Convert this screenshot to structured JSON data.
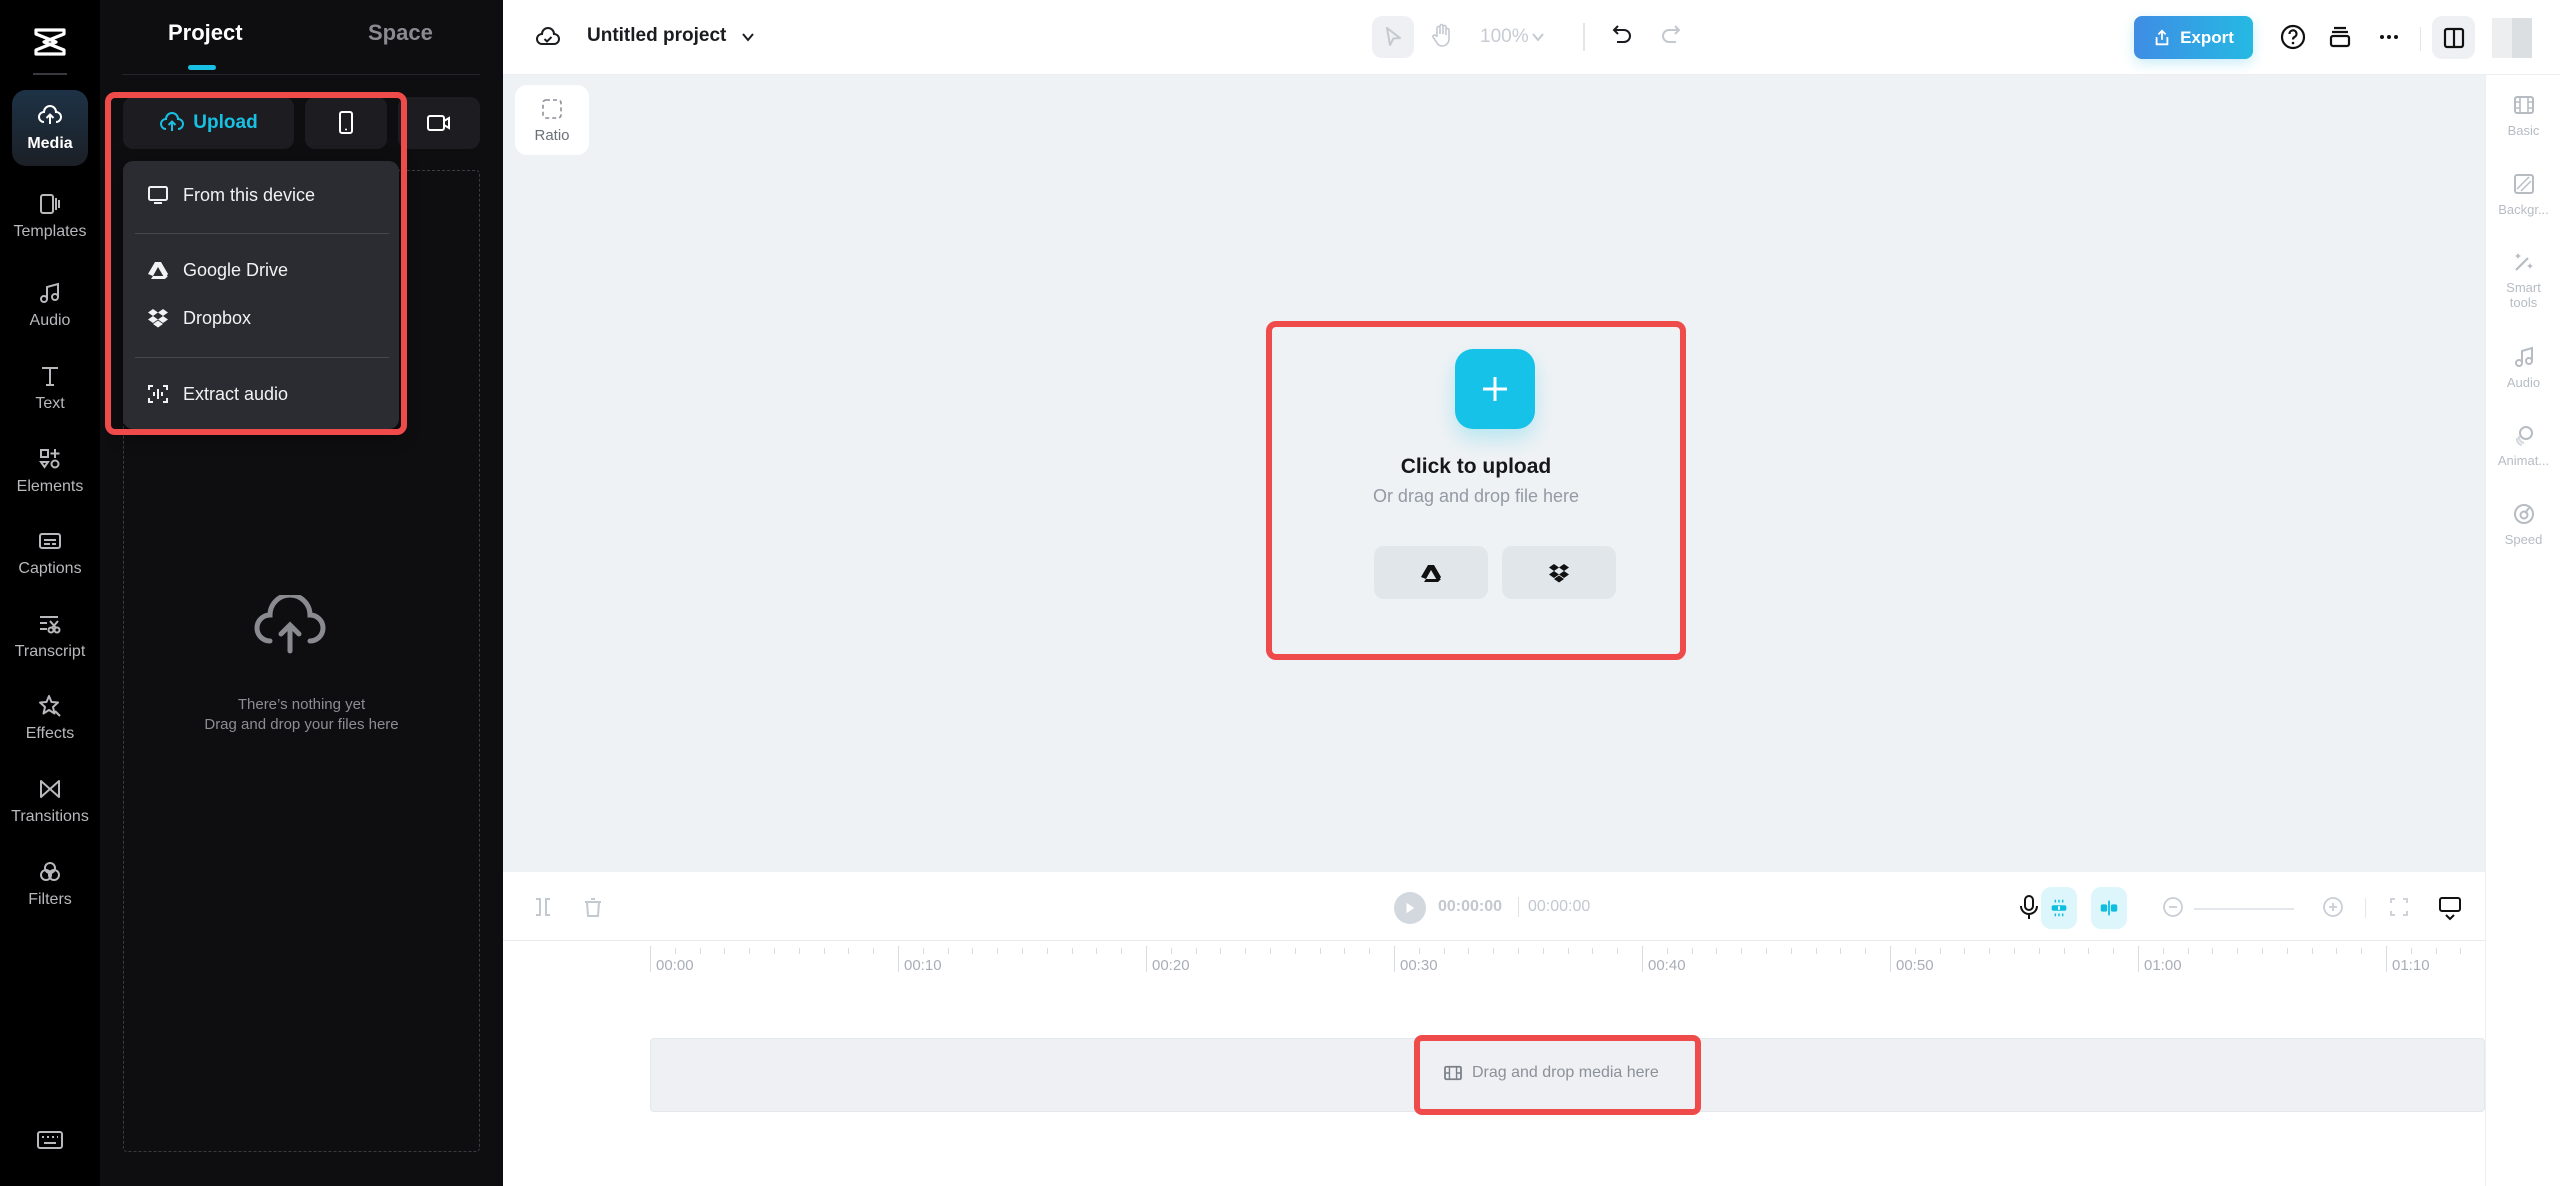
{
  "app": {
    "logo": "capcut-logo-icon"
  },
  "rail": {
    "items": [
      {
        "label": "Media",
        "icon": "cloud-upload-icon",
        "active": true
      },
      {
        "label": "Templates",
        "icon": "templates-icon"
      },
      {
        "label": "Audio",
        "icon": "music-note-icon"
      },
      {
        "label": "Text",
        "icon": "text-icon"
      },
      {
        "label": "Elements",
        "icon": "elements-icon"
      },
      {
        "label": "Captions",
        "icon": "captions-icon"
      },
      {
        "label": "Transcript",
        "icon": "transcript-icon"
      },
      {
        "label": "Effects",
        "icon": "effects-star-icon"
      },
      {
        "label": "Transitions",
        "icon": "transitions-icon"
      },
      {
        "label": "Filters",
        "icon": "filters-icon"
      }
    ],
    "keyboard_icon": "keyboard-icon"
  },
  "panel": {
    "tabs": [
      {
        "label": "Project",
        "active": true
      },
      {
        "label": "Space",
        "active": false
      }
    ],
    "upload_label": "Upload",
    "empty_line1": "There’s nothing yet",
    "empty_line2": "Drag and drop your files here"
  },
  "upload_menu": {
    "items": [
      {
        "label": "From this device",
        "icon": "monitor-icon"
      },
      {
        "label": "Google Drive",
        "icon": "google-drive-icon"
      },
      {
        "label": "Dropbox",
        "icon": "dropbox-icon"
      },
      {
        "label": "Extract audio",
        "icon": "extract-audio-icon"
      }
    ]
  },
  "header": {
    "project_title": "Untitled project",
    "zoom_level": "100%",
    "export_label": "Export"
  },
  "canvas": {
    "ratio_label": "Ratio",
    "click_to_upload": "Click to upload",
    "drag_hint": "Or drag and drop file here"
  },
  "right_panel": {
    "items": [
      {
        "label": "Basic",
        "icon": "basic-icon"
      },
      {
        "label": "Backgr...",
        "icon": "background-icon"
      },
      {
        "label": "Smart tools",
        "icon": "magic-wand-icon"
      },
      {
        "label": "Audio",
        "icon": "music-note-icon"
      },
      {
        "label": "Animat...",
        "icon": "animation-icon"
      },
      {
        "label": "Speed",
        "icon": "speed-icon"
      }
    ]
  },
  "timeline": {
    "current_time": "00:00:00",
    "total_time": "00:00:00",
    "ruler_labels": [
      "00:00",
      "00:10",
      "00:20",
      "00:30",
      "00:40",
      "00:50",
      "01:00",
      "01:10"
    ],
    "track_placeholder": "Drag and drop media here"
  },
  "colors": {
    "accent": "#18c1e4",
    "highlight": "#f04b4b",
    "export_gradient_start": "#3f8de4",
    "export_gradient_end": "#25b9e3"
  }
}
